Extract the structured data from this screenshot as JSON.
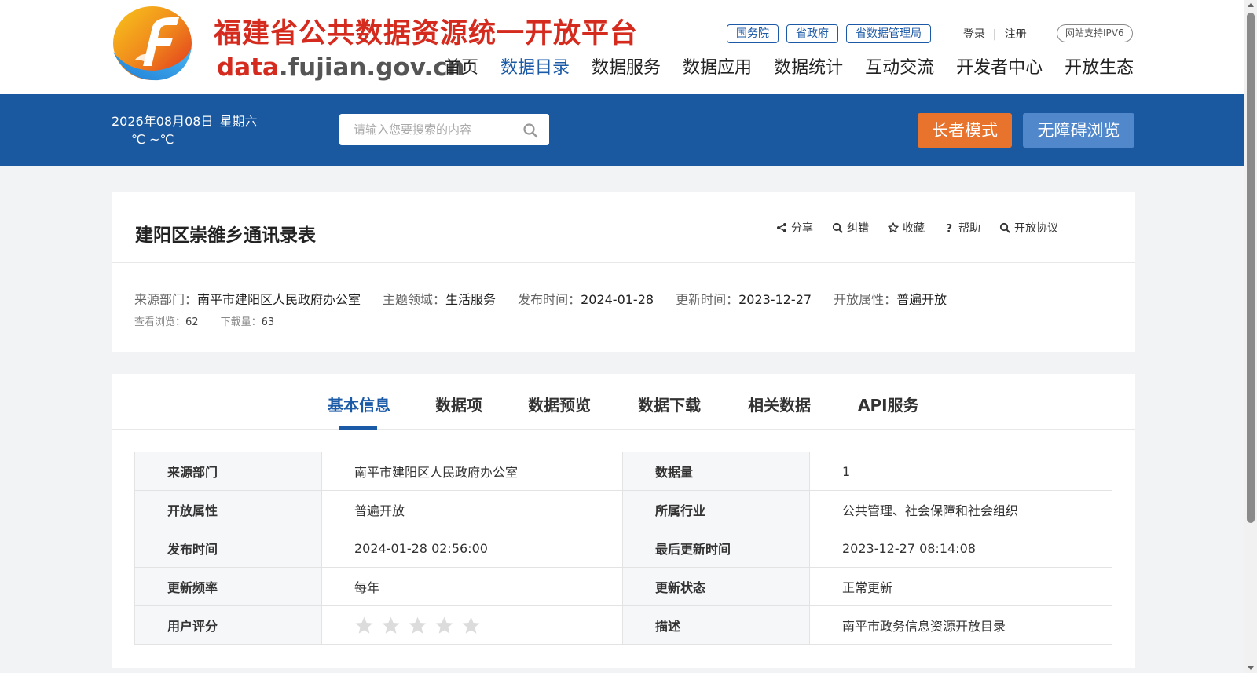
{
  "header": {
    "title_cn": "福建省公共数据资源统一开放平台",
    "title_en_prefix": "data",
    "title_en_suffix": ".fujian.gov.cn",
    "gov_links": [
      "国务院",
      "省政府",
      "省数据管理局"
    ],
    "login": "登录",
    "separator": "|",
    "register": "注册",
    "ipv6": "网站支持IPV6",
    "nav": [
      "首页",
      "数据目录",
      "数据服务",
      "数据应用",
      "数据统计",
      "互动交流",
      "开发者中心",
      "开放生态"
    ],
    "active_nav": "数据目录"
  },
  "bar": {
    "date": "2026年08月08日",
    "weekday": "星期六",
    "temperature": "℃ ~℃",
    "search_placeholder": "请输入您要搜索的内容",
    "elder_mode": "长者模式",
    "accessible": "无障碍浏览"
  },
  "dataset": {
    "title": "建阳区崇雒乡通讯录表",
    "actions": [
      "分享",
      "纠错",
      "收藏",
      "帮助",
      "开放协议"
    ],
    "meta": [
      {
        "label": "来源部门：",
        "value": "南平市建阳区人民政府办公室"
      },
      {
        "label": "主题领域：",
        "value": "生活服务"
      },
      {
        "label": "发布时间：",
        "value": "2024-01-28"
      },
      {
        "label": "更新时间：",
        "value": "2023-12-27"
      },
      {
        "label": "开放属性：",
        "value": "普遍开放"
      }
    ],
    "views_label": "查看浏览：",
    "views": "62",
    "downloads_label": "下载量：",
    "downloads": "63"
  },
  "tabs": [
    "基本信息",
    "数据项",
    "数据预览",
    "数据下载",
    "相关数据",
    "API服务"
  ],
  "active_tab": "基本信息",
  "info_table": [
    {
      "l1": "来源部门",
      "v1": "南平市建阳区人民政府办公室",
      "l2": "数据量",
      "v2": "1"
    },
    {
      "l1": "开放属性",
      "v1": "普遍开放",
      "l2": "所属行业",
      "v2": "公共管理、社会保障和社会组织"
    },
    {
      "l1": "发布时间",
      "v1": "2024-01-28 02:56:00",
      "l2": "最后更新时间",
      "v2": "2023-12-27 08:14:08"
    },
    {
      "l1": "更新频率",
      "v1": "每年",
      "l2": "更新状态",
      "v2": "正常更新"
    },
    {
      "l1": "用户评分",
      "v1": "",
      "l2": "描述",
      "v2": "南平市政务信息资源开放目录"
    }
  ],
  "rating": {
    "score": 0,
    "max": 5
  },
  "colors": {
    "brand_blue": "#1a58a0",
    "title_red": "#d42b1e",
    "elder_orange": "#e8732d",
    "accessible_blue": "#5188cc",
    "star_empty": "#dcdcdc"
  }
}
